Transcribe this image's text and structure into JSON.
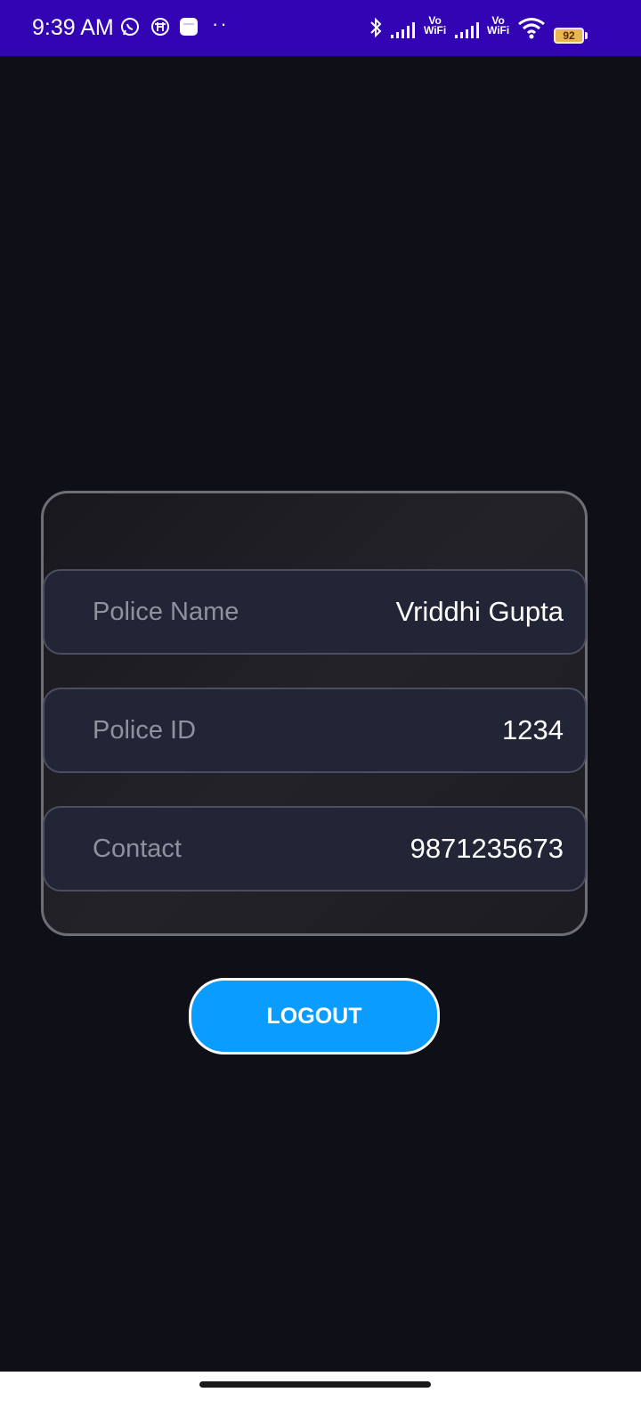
{
  "status_bar": {
    "time": "9:39 AM",
    "dots": "··",
    "vo_wifi_1": "Vo\nWiFi",
    "vo_wifi_2": "Vo\nWiFi",
    "battery": "92",
    "icons": [
      "whatsapp-icon",
      "h-circle-icon",
      "app-icon",
      "bluetooth-icon",
      "signal-icon",
      "signal-icon",
      "wifi-icon",
      "battery-icon"
    ]
  },
  "profile": {
    "rows": [
      {
        "label": "Police Name",
        "value": "Vriddhi Gupta"
      },
      {
        "label": "Police ID",
        "value": "1234"
      },
      {
        "label": "Contact",
        "value": "9871235673"
      }
    ]
  },
  "actions": {
    "logout_label": "LOGOUT"
  },
  "colors": {
    "status_bar": "#3204b4",
    "background": "#0f0f17",
    "row_background": "#222535",
    "logout_button": "#0b9cff"
  }
}
